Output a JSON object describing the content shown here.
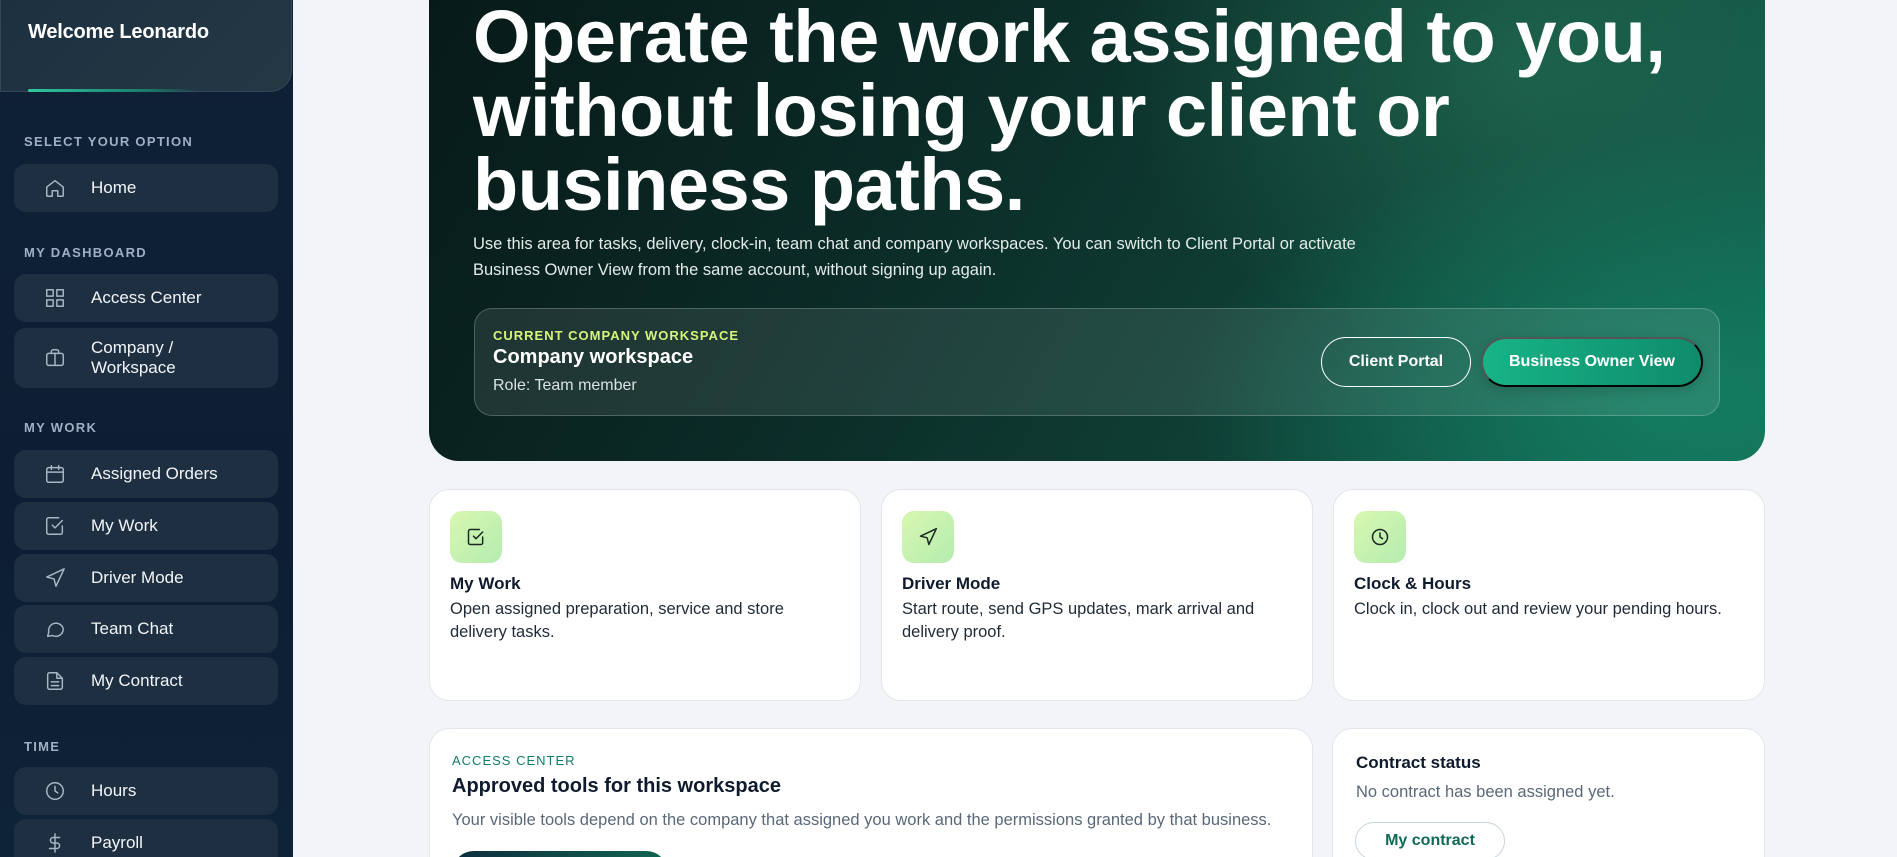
{
  "sidebar": {
    "welcome": "Welcome Leonardo",
    "sections": [
      {
        "label": "SELECT YOUR OPTION"
      },
      {
        "label": "MY DASHBOARD"
      },
      {
        "label": "MY WORK"
      },
      {
        "label": "TIME"
      }
    ],
    "items": [
      {
        "label": "Home",
        "icon": "home-icon"
      },
      {
        "label": "Access Center",
        "icon": "grid-icon"
      },
      {
        "label": "Company / Workspace",
        "icon": "briefcase-icon"
      },
      {
        "label": "Assigned Orders",
        "icon": "calendar-icon"
      },
      {
        "label": "My Work",
        "icon": "check-square-icon"
      },
      {
        "label": "Driver Mode",
        "icon": "navigation-icon"
      },
      {
        "label": "Team Chat",
        "icon": "chat-bubble-icon"
      },
      {
        "label": "My Contract",
        "icon": "document-icon"
      },
      {
        "label": "Hours",
        "icon": "clock-icon"
      },
      {
        "label": "Payroll",
        "icon": "dollar-icon"
      }
    ]
  },
  "hero": {
    "title_line1": "Operate the work assigned to you,",
    "title_line2": "without losing your client or",
    "title_line3": "business paths.",
    "description": "Use this area for tasks, delivery, clock-in, team chat and company workspaces. You can switch to Client Portal or activate Business Owner View from the same account, without signing up again.",
    "workspace": {
      "kicker": "CURRENT COMPANY WORKSPACE",
      "name": "Company workspace",
      "role": "Role: Team member",
      "client_portal_label": "Client Portal",
      "business_owner_label": "Business Owner View"
    }
  },
  "features": [
    {
      "title": "My Work",
      "description": "Open assigned preparation, service and store delivery tasks.",
      "icon": "check-square-icon"
    },
    {
      "title": "Driver Mode",
      "description": "Start route, send GPS updates, mark arrival and delivery proof.",
      "icon": "navigation-icon"
    },
    {
      "title": "Clock & Hours",
      "description": "Clock in, clock out and review your pending hours.",
      "icon": "clock-icon"
    }
  ],
  "access_center": {
    "kicker": "ACCESS CENTER",
    "title": "Approved tools for this workspace",
    "description": "Your visible tools depend on the company that assigned you work and the permissions granted by that business."
  },
  "contract": {
    "title": "Contract status",
    "status": "No contract has been assigned yet.",
    "button_label": "My contract"
  },
  "colors": {
    "sidebar_bg": "#0f2136",
    "accent_green": "#17b487",
    "kicker_lime": "#d6f57a",
    "main_bg": "#f2f4f7"
  }
}
